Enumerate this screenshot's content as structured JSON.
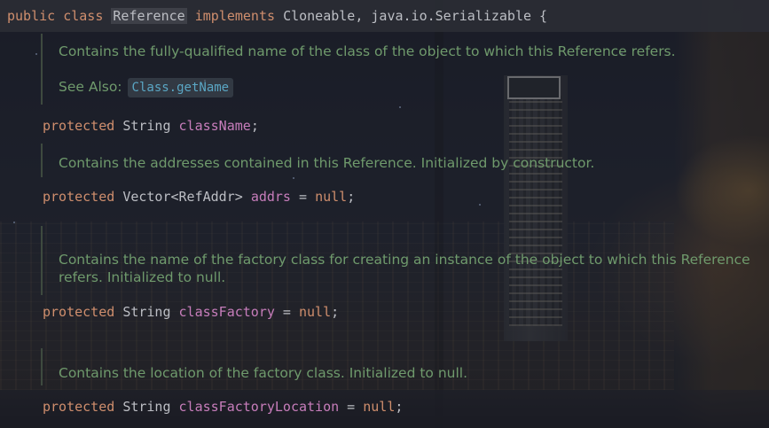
{
  "declaration": {
    "kw_public": "public",
    "kw_class": "class",
    "class_name": "Reference",
    "kw_implements": "implements",
    "interfaces": "Cloneable, java.io.Serializable {"
  },
  "docs": [
    {
      "text": "Contains the fully-qualified name of the class of the object to which this Reference refers."
    },
    {
      "text": "Contains the addresses contained in this Reference. Initialized by constructor."
    },
    {
      "text": "Contains the name of the factory class for creating an instance of the object to which this Reference refers. Initialized to null."
    },
    {
      "text": "Contains the location of the factory class. Initialized to null."
    }
  ],
  "see_also": {
    "label": "See Also:",
    "link": "Class.getName"
  },
  "fields": [
    {
      "modifier": "protected",
      "type": "String",
      "name": "className",
      "init": "",
      "end": ";"
    },
    {
      "modifier": "protected",
      "type": "Vector<RefAddr>",
      "name": "addrs",
      "init": " = ",
      "value": "null",
      "end": ";"
    },
    {
      "modifier": "protected",
      "type": "String",
      "name": "classFactory",
      "init": " = ",
      "value": "null",
      "end": ";"
    },
    {
      "modifier": "protected",
      "type": "String",
      "name": "classFactoryLocation",
      "init": " = ",
      "value": "null",
      "end": ";"
    }
  ]
}
